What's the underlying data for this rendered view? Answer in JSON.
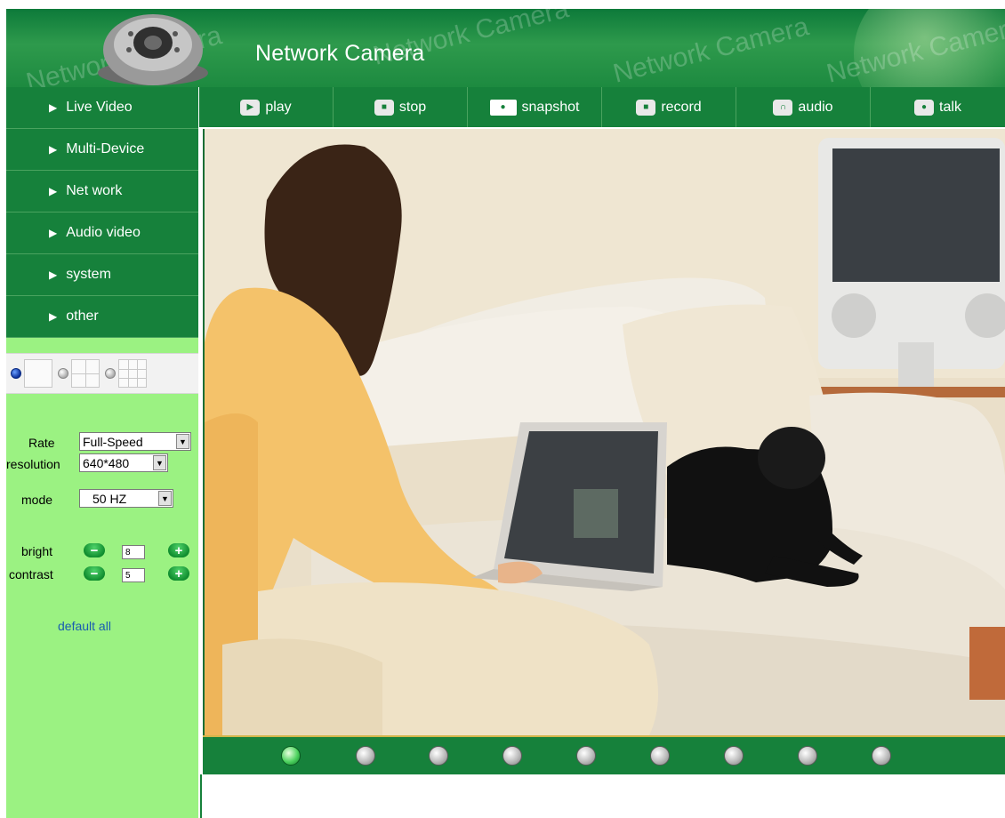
{
  "header": {
    "title": "Network Camera",
    "watermark": "Network Camera"
  },
  "menu": {
    "items": [
      {
        "label": "Live Video"
      },
      {
        "label": "Multi-Device"
      },
      {
        "label": "Net work"
      },
      {
        "label": "Audio video"
      },
      {
        "label": "system"
      },
      {
        "label": "other"
      }
    ]
  },
  "layout_options": {
    "selected": "single",
    "options": [
      "single",
      "quad",
      "nine"
    ]
  },
  "controls": {
    "rate_label": "Rate",
    "rate_value": "Full-Speed",
    "resolution_label": "resolution",
    "resolution_value": "640*480",
    "mode_label": "mode",
    "mode_value": "50 HZ",
    "bright_label": "bright",
    "bright_value": "8",
    "contrast_label": "contrast",
    "contrast_value": "5",
    "minus": "−",
    "plus": "+",
    "default_all": "default all"
  },
  "toolbar": {
    "play": "play",
    "stop": "stop",
    "snapshot": "snapshot",
    "record": "record",
    "audio": "audio",
    "talk": "talk"
  },
  "channels": {
    "count": 9,
    "active_index": 0
  },
  "colors": {
    "primary_green": "#16813b",
    "panel_green": "#9bf282",
    "link_blue": "#1a5db0"
  }
}
